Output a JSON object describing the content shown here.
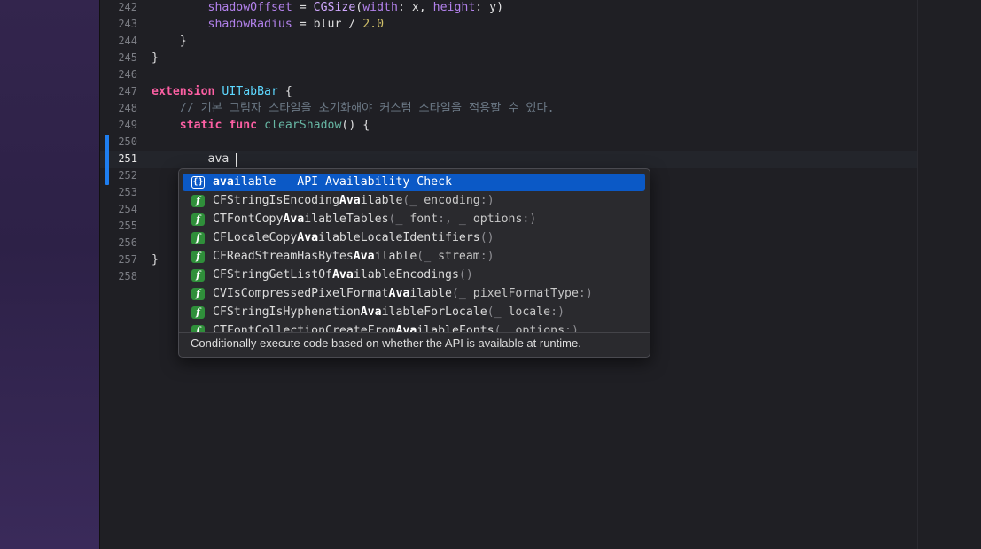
{
  "editor": {
    "current_line": "251",
    "typed_text": "ava",
    "lines": [
      {
        "no": "242",
        "indent": "        ",
        "t": [
          [
            "shadowOffset",
            "prop"
          ],
          [
            " = ",
            "pl"
          ],
          [
            "CGSize",
            "typ2"
          ],
          [
            "(",
            "pl"
          ],
          [
            "width",
            "prop"
          ],
          [
            ": x, ",
            "pl"
          ],
          [
            "height",
            "prop"
          ],
          [
            ": y)",
            "pl"
          ]
        ]
      },
      {
        "no": "243",
        "indent": "        ",
        "t": [
          [
            "shadowRadius",
            "prop"
          ],
          [
            " = blur / ",
            "pl"
          ],
          [
            "2.0",
            "num"
          ]
        ]
      },
      {
        "no": "244",
        "indent": "    ",
        "t": [
          [
            "}",
            "pl"
          ]
        ]
      },
      {
        "no": "245",
        "indent": "",
        "t": [
          [
            "}",
            "pl"
          ]
        ]
      },
      {
        "no": "246",
        "indent": "",
        "t": []
      },
      {
        "no": "247",
        "indent": "",
        "t": [
          [
            "extension",
            "kw"
          ],
          [
            " ",
            "pl"
          ],
          [
            "UITabBar",
            "type"
          ],
          [
            " {",
            "pl"
          ]
        ]
      },
      {
        "no": "248",
        "indent": "    ",
        "t": [
          [
            "// 기본 그림자 스타일을 초기화해야 커스텀 스타일을 적용할 수 있다.",
            "cm"
          ]
        ]
      },
      {
        "no": "249",
        "indent": "    ",
        "t": [
          [
            "static",
            "kw"
          ],
          [
            " ",
            "pl"
          ],
          [
            "func",
            "kw"
          ],
          [
            " ",
            "pl"
          ],
          [
            "clearShadow",
            "fn"
          ],
          [
            "() {",
            "pl"
          ]
        ]
      },
      {
        "no": "250",
        "indent": "",
        "t": []
      },
      {
        "no": "251",
        "indent": "        ",
        "t": [
          [
            "ava",
            "pl"
          ]
        ]
      },
      {
        "no": "252",
        "indent": "",
        "t": []
      },
      {
        "no": "253",
        "indent": "",
        "t": []
      },
      {
        "no": "254",
        "indent": "",
        "t": []
      },
      {
        "no": "255",
        "indent": "",
        "t": []
      },
      {
        "no": "256",
        "indent": "",
        "t": []
      },
      {
        "no": "257",
        "indent": "",
        "t": [
          [
            "}",
            "pl"
          ]
        ]
      },
      {
        "no": "258",
        "indent": "",
        "t": []
      }
    ]
  },
  "completion": {
    "description": "Conditionally execute code based on whether the API is available at runtime.",
    "items": [
      {
        "icon": "braces-icon",
        "badge": "{}",
        "selected": true,
        "parts": [
          [
            "ava",
            "mt"
          ],
          [
            "ilable – API Availability Check",
            "plain"
          ]
        ]
      },
      {
        "icon": "function-icon",
        "badge": "f",
        "parts": [
          [
            "CFStringIsEncoding",
            "plain"
          ],
          [
            "Ava",
            "mt"
          ],
          [
            "ilable",
            "plain"
          ],
          [
            "(_ ",
            "dim"
          ],
          [
            "encoding",
            "argc"
          ],
          [
            ":)",
            "dim"
          ]
        ]
      },
      {
        "icon": "function-icon",
        "badge": "f",
        "parts": [
          [
            "CTFontCopy",
            "plain"
          ],
          [
            "Ava",
            "mt"
          ],
          [
            "ilableTables",
            "plain"
          ],
          [
            "(_ ",
            "dim"
          ],
          [
            "font",
            "argc"
          ],
          [
            ":, _ ",
            "dim"
          ],
          [
            "options",
            "argc"
          ],
          [
            ":)",
            "dim"
          ]
        ]
      },
      {
        "icon": "function-icon",
        "badge": "f",
        "parts": [
          [
            "CFLocaleCopy",
            "plain"
          ],
          [
            "Ava",
            "mt"
          ],
          [
            "ilableLocaleIdentifiers",
            "plain"
          ],
          [
            "()",
            "dim"
          ]
        ]
      },
      {
        "icon": "function-icon",
        "badge": "f",
        "parts": [
          [
            "CFReadStreamHasBytes",
            "plain"
          ],
          [
            "Ava",
            "mt"
          ],
          [
            "ilable",
            "plain"
          ],
          [
            "(_ ",
            "dim"
          ],
          [
            "stream",
            "argc"
          ],
          [
            ":)",
            "dim"
          ]
        ]
      },
      {
        "icon": "function-icon",
        "badge": "f",
        "parts": [
          [
            "CFStringGetListOf",
            "plain"
          ],
          [
            "Ava",
            "mt"
          ],
          [
            "ilableEncodings",
            "plain"
          ],
          [
            "()",
            "dim"
          ]
        ]
      },
      {
        "icon": "function-icon",
        "badge": "f",
        "parts": [
          [
            "CVIsCompressedPixelFormat",
            "plain"
          ],
          [
            "Ava",
            "mt"
          ],
          [
            "ilable",
            "plain"
          ],
          [
            "(_ ",
            "dim"
          ],
          [
            "pixelFormatType",
            "argc"
          ],
          [
            ":)",
            "dim"
          ]
        ]
      },
      {
        "icon": "function-icon",
        "badge": "f",
        "parts": [
          [
            "CFStringIsHyphenation",
            "plain"
          ],
          [
            "Ava",
            "mt"
          ],
          [
            "ilableForLocale",
            "plain"
          ],
          [
            "(_ ",
            "dim"
          ],
          [
            "locale",
            "argc"
          ],
          [
            ":)",
            "dim"
          ]
        ]
      },
      {
        "icon": "function-icon",
        "badge": "f",
        "parts": [
          [
            "CTFontCollectionCreateFrom",
            "plain"
          ],
          [
            "Ava",
            "mt"
          ],
          [
            "ilableFonts",
            "plain"
          ],
          [
            "(_ ",
            "dim"
          ],
          [
            "options",
            "argc"
          ],
          [
            ":)",
            "dim"
          ]
        ]
      }
    ]
  },
  "colors": {
    "selection": "#0b59c6",
    "change_bar": "#1e7ef0",
    "keyword": "#fc5fa3",
    "type": "#5dd8ff"
  }
}
